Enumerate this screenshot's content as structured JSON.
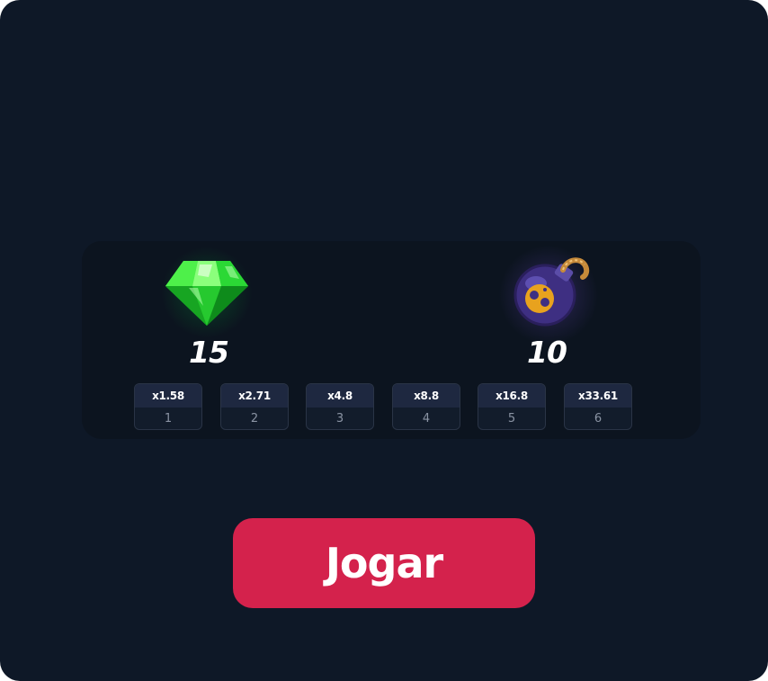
{
  "game": {
    "gems": {
      "icon": "green-gem-icon",
      "count": "15"
    },
    "bombs": {
      "icon": "bomb-icon",
      "count": "10"
    }
  },
  "multipliers": [
    {
      "value": "x1.58",
      "step": "1"
    },
    {
      "value": "x2.71",
      "step": "2"
    },
    {
      "value": "x4.8",
      "step": "3"
    },
    {
      "value": "x8.8",
      "step": "4"
    },
    {
      "value": "x16.8",
      "step": "5"
    },
    {
      "value": "x33.61",
      "step": "6"
    }
  ],
  "play_button": {
    "label": "Jogar",
    "color": "#d4224c"
  },
  "colors": {
    "background": "#0e1827",
    "panel": "#0c141f",
    "gem": "#1ed42e",
    "bomb": "#4a3a8c"
  }
}
